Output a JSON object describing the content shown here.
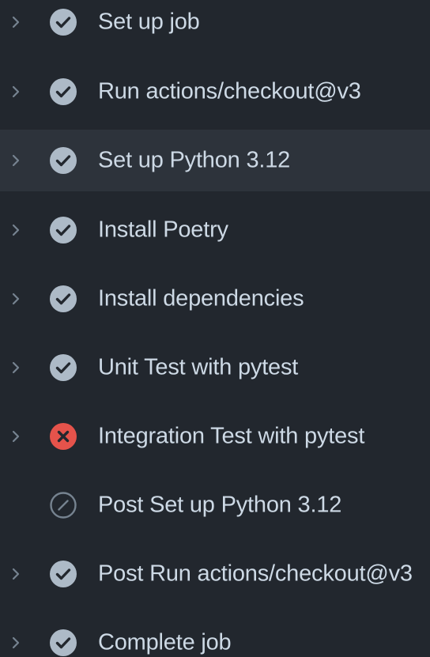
{
  "colors": {
    "background": "#22272e",
    "hover_row": "#2d333b",
    "text": "#cdd9e5",
    "success_icon": "#adbac7",
    "failure_icon": "#e5534b",
    "skipped_icon": "#768390",
    "chevron": "#768390"
  },
  "steps": [
    {
      "label": "Set up job",
      "status": "success",
      "expandable": true
    },
    {
      "label": "Run actions/checkout@v3",
      "status": "success",
      "expandable": true
    },
    {
      "label": "Set up Python 3.12",
      "status": "success",
      "expandable": true,
      "hovered": true
    },
    {
      "label": "Install Poetry",
      "status": "success",
      "expandable": true
    },
    {
      "label": "Install dependencies",
      "status": "success",
      "expandable": true
    },
    {
      "label": "Unit Test with pytest",
      "status": "success",
      "expandable": true
    },
    {
      "label": "Integration Test with pytest",
      "status": "failure",
      "expandable": true
    },
    {
      "label": "Post Set up Python 3.12",
      "status": "skipped",
      "expandable": false
    },
    {
      "label": "Post Run actions/checkout@v3",
      "status": "success",
      "expandable": true
    },
    {
      "label": "Complete job",
      "status": "success",
      "expandable": true
    }
  ]
}
